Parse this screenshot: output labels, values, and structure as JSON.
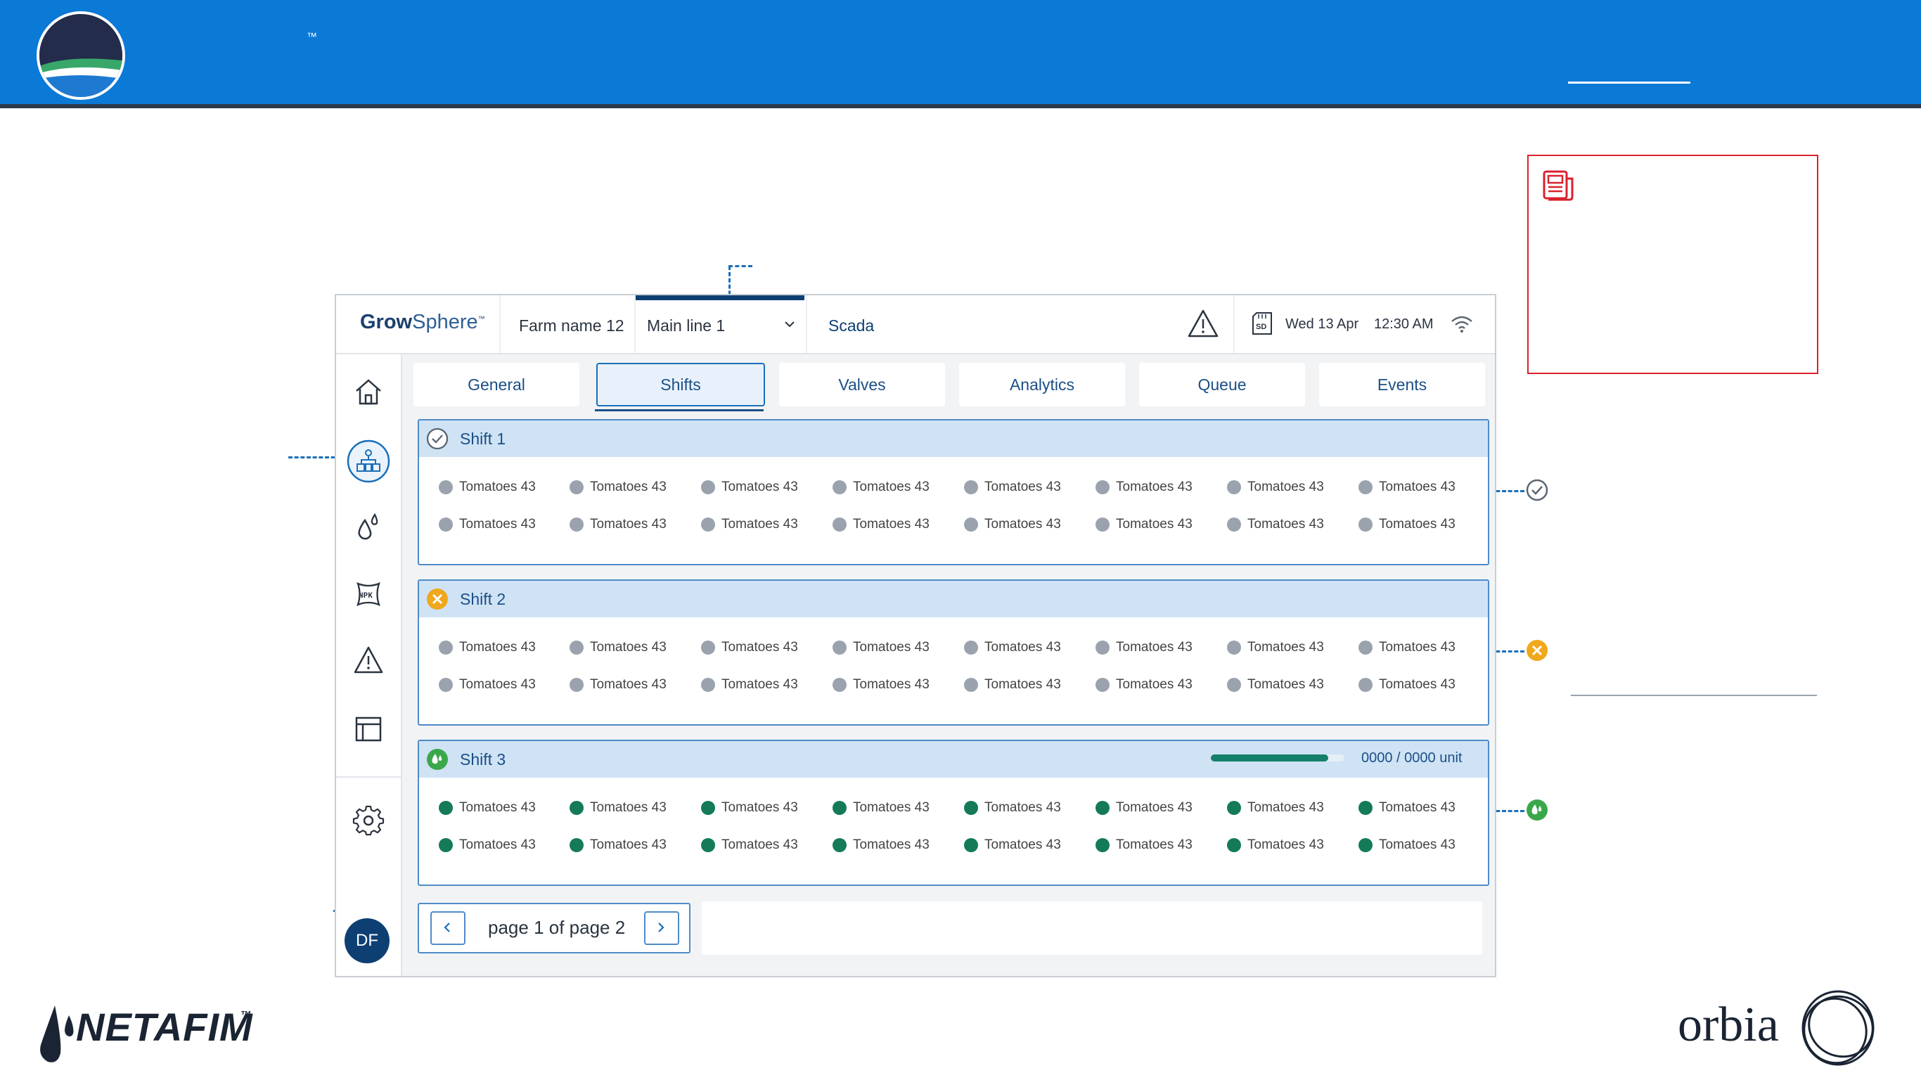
{
  "banner": {
    "trademark": "™"
  },
  "app": {
    "brand_bold": "Grow",
    "brand_light": "Sphere",
    "brand_tm": "™",
    "farm_name": "Farm name 12",
    "main_line": "Main line 1",
    "scada": "Scada",
    "date": "Wed 13 Apr",
    "time": "12:30 AM",
    "avatar_initials": "DF"
  },
  "tabs": [
    {
      "label": "General"
    },
    {
      "label": "Shifts",
      "active": true
    },
    {
      "label": "Valves"
    },
    {
      "label": "Analytics"
    },
    {
      "label": "Queue"
    },
    {
      "label": "Events"
    }
  ],
  "shifts": [
    {
      "title": "Shift 1",
      "status_icon": "check-circle-icon",
      "items": [
        "Tomatoes 43",
        "Tomatoes 43",
        "Tomatoes 43",
        "Tomatoes 43",
        "Tomatoes 43",
        "Tomatoes 43",
        "Tomatoes 43",
        "Tomatoes 43",
        "Tomatoes 43",
        "Tomatoes 43",
        "Tomatoes 43",
        "Tomatoes 43",
        "Tomatoes 43",
        "Tomatoes 43",
        "Tomatoes 43",
        "Tomatoes 43"
      ],
      "active_items": false
    },
    {
      "title": "Shift 2",
      "status_icon": "x-circle-icon",
      "items": [
        "Tomatoes 43",
        "Tomatoes 43",
        "Tomatoes 43",
        "Tomatoes 43",
        "Tomatoes 43",
        "Tomatoes 43",
        "Tomatoes 43",
        "Tomatoes 43",
        "Tomatoes 43",
        "Tomatoes 43",
        "Tomatoes 43",
        "Tomatoes 43",
        "Tomatoes 43",
        "Tomatoes 43",
        "Tomatoes 43",
        "Tomatoes 43"
      ],
      "active_items": false
    },
    {
      "title": "Shift 3",
      "status_icon": "drop-circle-icon",
      "progress_text": "0000 / 0000 unit",
      "progress": 0.88,
      "items": [
        "Tomatoes 43",
        "Tomatoes 43",
        "Tomatoes 43",
        "Tomatoes 43",
        "Tomatoes 43",
        "Tomatoes 43",
        "Tomatoes 43",
        "Tomatoes 43",
        "Tomatoes 43",
        "Tomatoes 43",
        "Tomatoes 43",
        "Tomatoes 43",
        "Tomatoes 43",
        "Tomatoes 43",
        "Tomatoes 43",
        "Tomatoes 43"
      ],
      "active_items": true
    }
  ],
  "pagination": {
    "text": "page 1 of page 2"
  },
  "colors": {
    "banner": "#0b79d6",
    "primary": "#1b4f86",
    "active_dot": "#147a58",
    "inactive_dot": "#9aa3ad",
    "warning": "#f0a81c",
    "success": "#3aa84a",
    "note_border": "#d9232e"
  },
  "footer": {
    "netafim": "NETAFIM",
    "netafim_tm": "™",
    "orbia": "orbia"
  }
}
